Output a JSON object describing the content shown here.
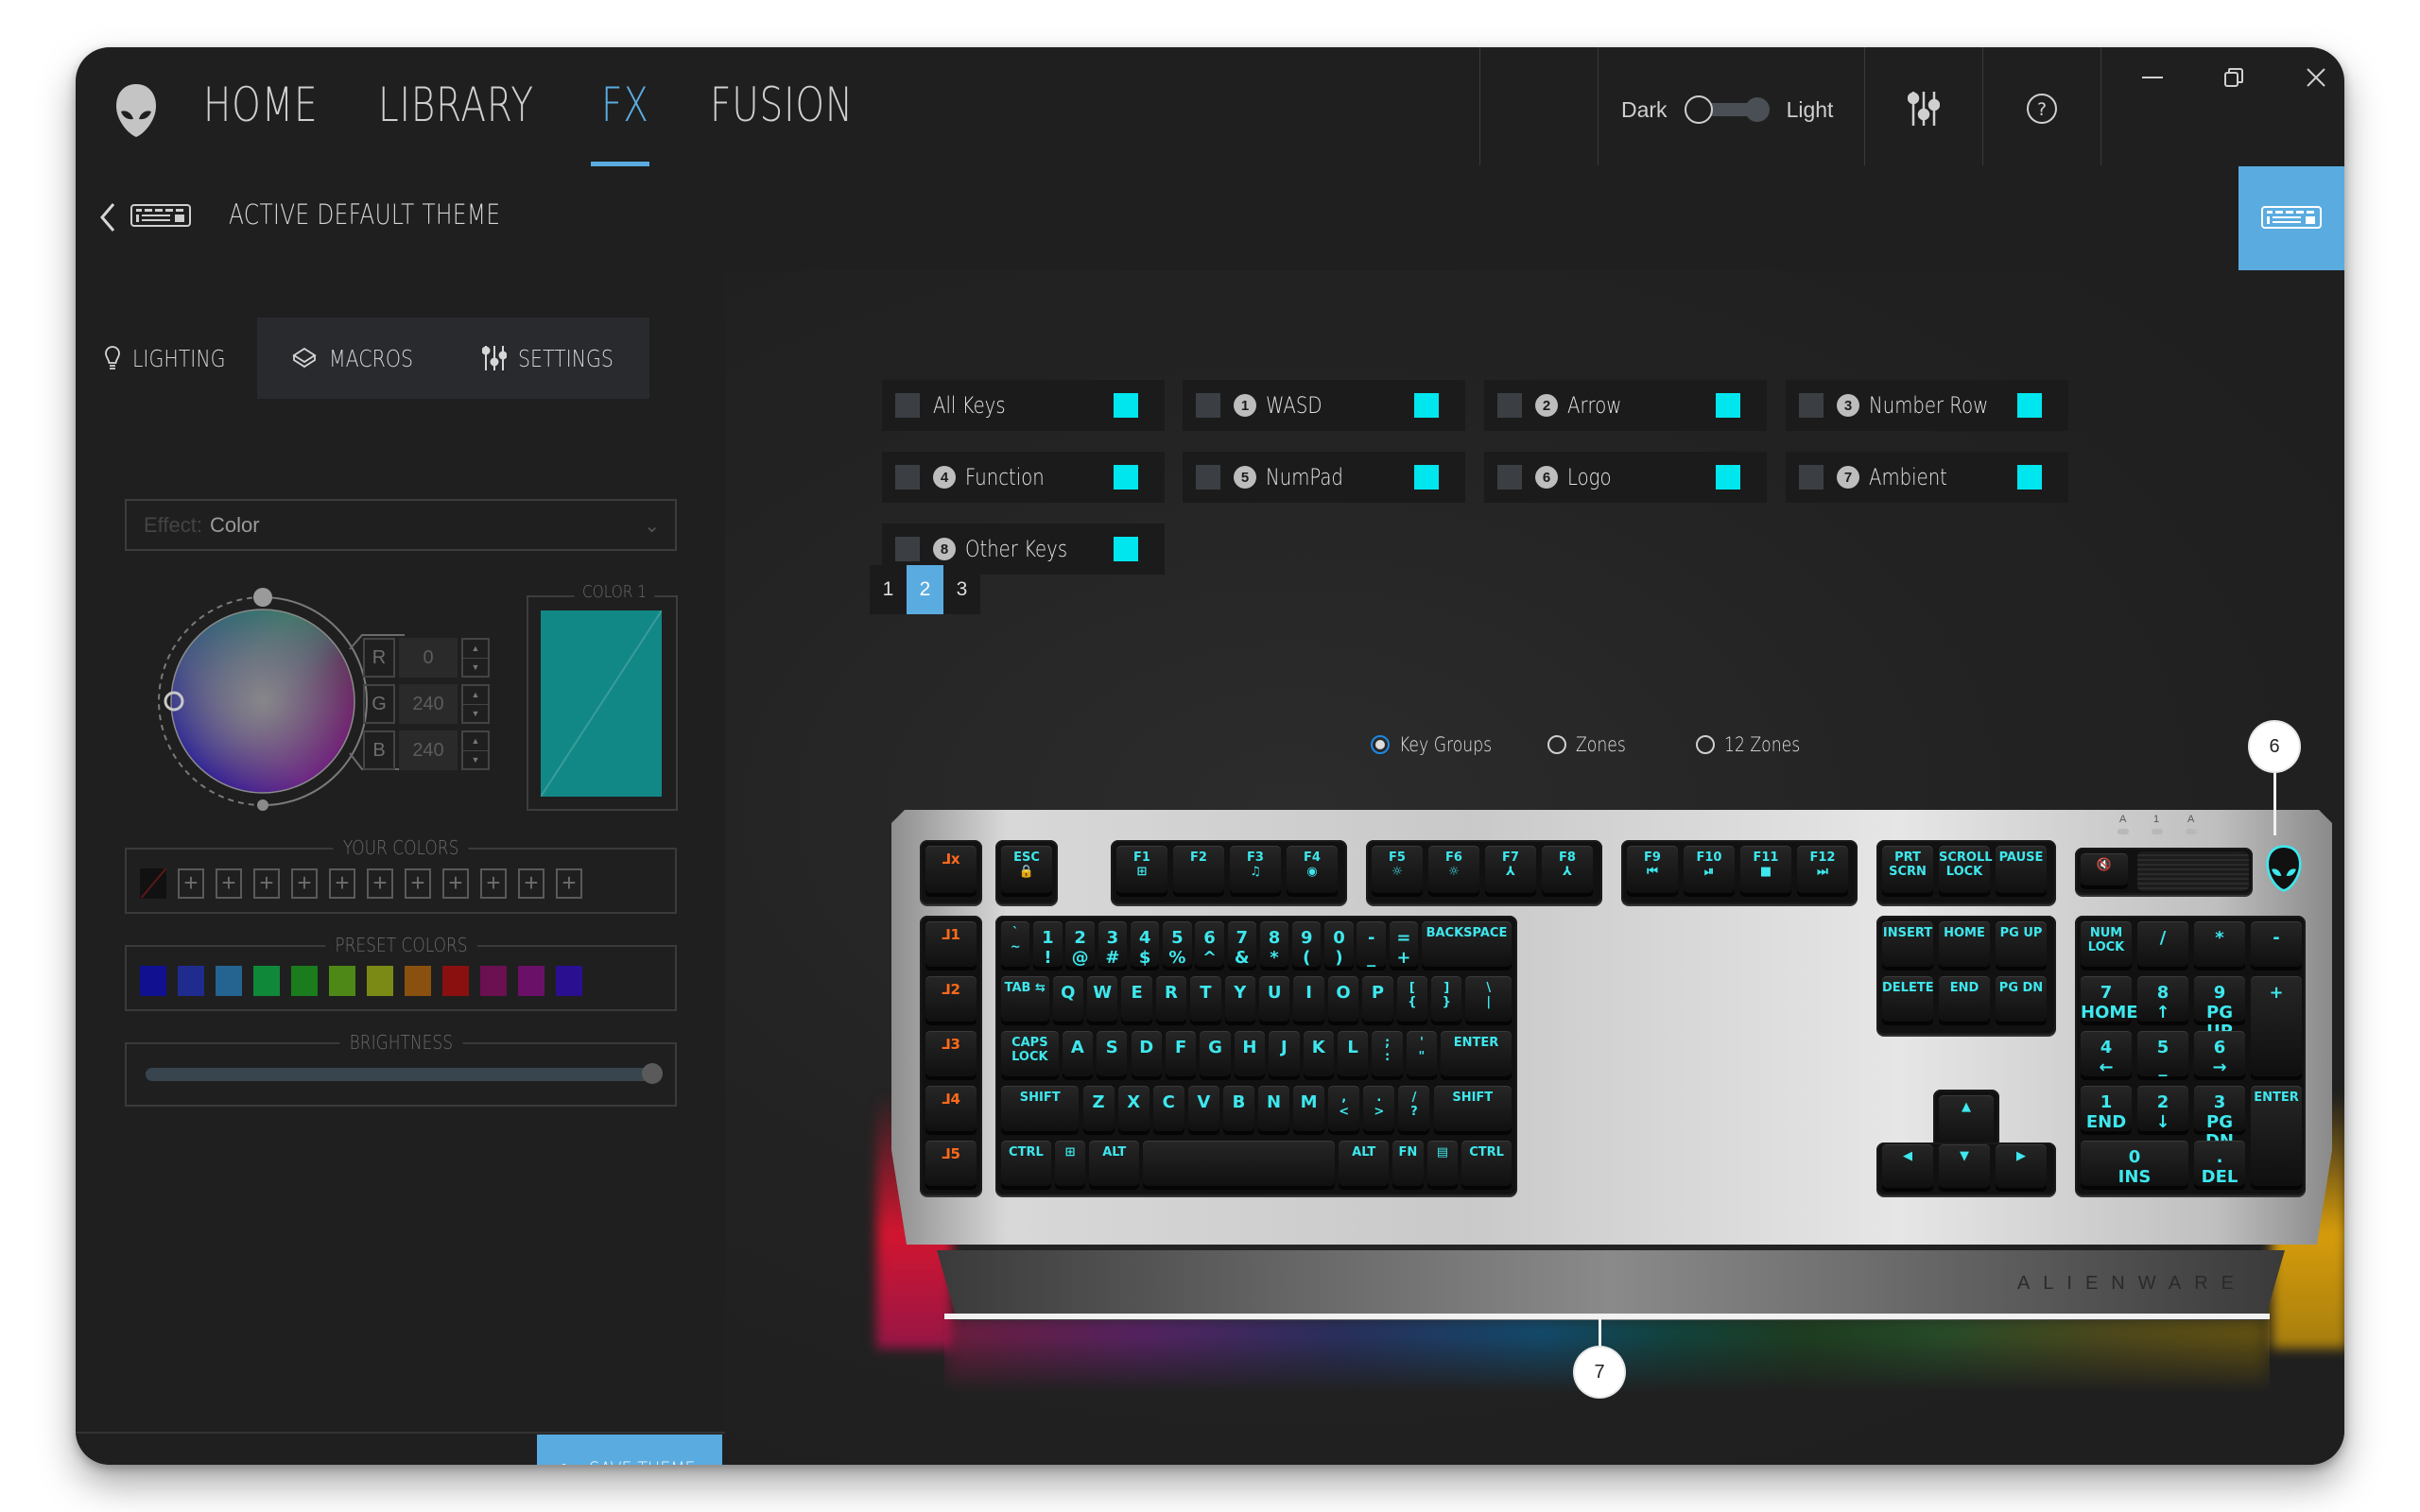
{
  "app": {
    "nav": [
      {
        "label": "HOME",
        "active": false
      },
      {
        "label": "LIBRARY",
        "active": false
      },
      {
        "label": "FX",
        "active": true
      },
      {
        "label": "FUSION",
        "active": false
      }
    ],
    "theme_toggle": {
      "left_label": "Dark",
      "right_label": "Light",
      "value": "Dark"
    },
    "icons": {
      "settings": "sliders-icon",
      "help": "help-icon",
      "minimize": "minimize-icon",
      "restore": "restore-icon",
      "close": "close-icon"
    },
    "accent_color": "#5aace0"
  },
  "subheader": {
    "title": "ACTIVE DEFAULT THEME"
  },
  "left_panel": {
    "tabs": [
      {
        "label": "LIGHTING",
        "icon": "bulb-icon"
      },
      {
        "label": "MACROS",
        "icon": "layers-icon"
      },
      {
        "label": "SETTINGS",
        "icon": "sliders-icon"
      }
    ],
    "effect": {
      "prefix": "Effect:",
      "value": "Color"
    },
    "rgb": {
      "r": "0",
      "g": "240",
      "b": "240",
      "labels": [
        "R",
        "G",
        "B"
      ]
    },
    "color1": {
      "title": "COLOR 1",
      "hex": "#128886"
    },
    "your_colors": {
      "title": "YOUR COLORS",
      "slots": 11
    },
    "preset_colors": {
      "title": "PRESET COLORS",
      "swatches": [
        "#101090",
        "#1f2c8e",
        "#256391",
        "#10883a",
        "#1a7c1c",
        "#4e8816",
        "#7a8a14",
        "#8a5010",
        "#8a1010",
        "#6b1050",
        "#6b1068",
        "#2a1090"
      ]
    },
    "brightness": {
      "title": "BRIGHTNESS",
      "value_percent": 100
    },
    "save_button": "SAVE THEME"
  },
  "key_groups": {
    "items": [
      {
        "num": "",
        "label": "All Keys",
        "color": "#00e6ee"
      },
      {
        "num": "1",
        "label": "WASD",
        "color": "#00e6ee"
      },
      {
        "num": "2",
        "label": "Arrow",
        "color": "#00e6ee"
      },
      {
        "num": "3",
        "label": "Number Row",
        "color": "#00e6ee"
      },
      {
        "num": "4",
        "label": "Function",
        "color": "#00e6ee"
      },
      {
        "num": "5",
        "label": "NumPad",
        "color": "#00e6ee"
      },
      {
        "num": "6",
        "label": "Logo",
        "color": "#00e6ee"
      },
      {
        "num": "7",
        "label": "Ambient",
        "color": "#00e6ee"
      },
      {
        "num": "8",
        "label": "Other Keys",
        "color": "#00e6ee"
      }
    ],
    "pages": [
      "1",
      "2",
      "3"
    ],
    "active_page": "2"
  },
  "mode": {
    "options": [
      "Key Groups",
      "Zones",
      "12 Zones"
    ],
    "selected": "Key Groups"
  },
  "keyboard": {
    "brand": "ALIENWARE",
    "callouts": [
      "6",
      "7"
    ],
    "led_labels": [
      "A",
      "1",
      "A"
    ],
    "macro_keys": [
      "⅃x",
      "⅃1",
      "⅃2",
      "⅃3",
      "⅃4",
      "⅃5"
    ],
    "esc": "ESC\n🔒",
    "fkeys": [
      "F1",
      "F2",
      "F3",
      "F4",
      "F5",
      "F6",
      "F7",
      "F8",
      "F9",
      "F10",
      "F11",
      "F12"
    ],
    "fkey_sub": [
      "⊞",
      "",
      "♫",
      "◉",
      "☼",
      "☼",
      "⅄",
      "⅄",
      "⏮",
      "⏯",
      "■",
      "⏭"
    ],
    "sys_keys": [
      "PRT\nSCRN",
      "SCROLL\nLOCK",
      "PAUSE"
    ],
    "mute": "🔇",
    "row1": [
      "`\n~",
      "1\n!",
      "2\n@",
      "3\n#",
      "4\n$",
      "5\n%",
      "6\n^",
      "7\n&",
      "8\n*",
      "9\n(",
      "0\n)",
      "-\n_",
      "=\n+",
      "BACKSPACE"
    ],
    "row2": [
      "TAB ⇆",
      "Q",
      "W",
      "E",
      "R",
      "T",
      "Y",
      "U",
      "I",
      "O",
      "P",
      "[\n{",
      "]\n}",
      "\\\n|"
    ],
    "row3": [
      "CAPS LOCK",
      "A",
      "S",
      "D",
      "F",
      "G",
      "H",
      "J",
      "K",
      "L",
      ";\n:",
      "'\n\"",
      "ENTER"
    ],
    "row4": [
      "SHIFT",
      "Z",
      "X",
      "C",
      "V",
      "B",
      "N",
      "M",
      ",\n<",
      ".\n>",
      "/\n?",
      "SHIFT"
    ],
    "row5": [
      "CTRL",
      "⊞",
      "ALT",
      "",
      "ALT",
      "FN",
      "▤",
      "CTRL"
    ],
    "nav_keys": [
      "INSERT",
      "HOME",
      "PG UP",
      "DELETE",
      "END",
      "PG DN"
    ],
    "arrows": [
      "▲",
      "◀",
      "▼",
      "▶"
    ],
    "numpad": [
      "NUM\nLOCK",
      "/",
      "*",
      "-",
      "7\nHOME",
      "8\n↑",
      "9\nPG UP",
      "+",
      "4\n←",
      "5\n_",
      "6\n→",
      "1\nEND",
      "2\n↓",
      "3\nPG DN",
      "ENTER",
      "0\nINS",
      ".\nDEL"
    ]
  }
}
